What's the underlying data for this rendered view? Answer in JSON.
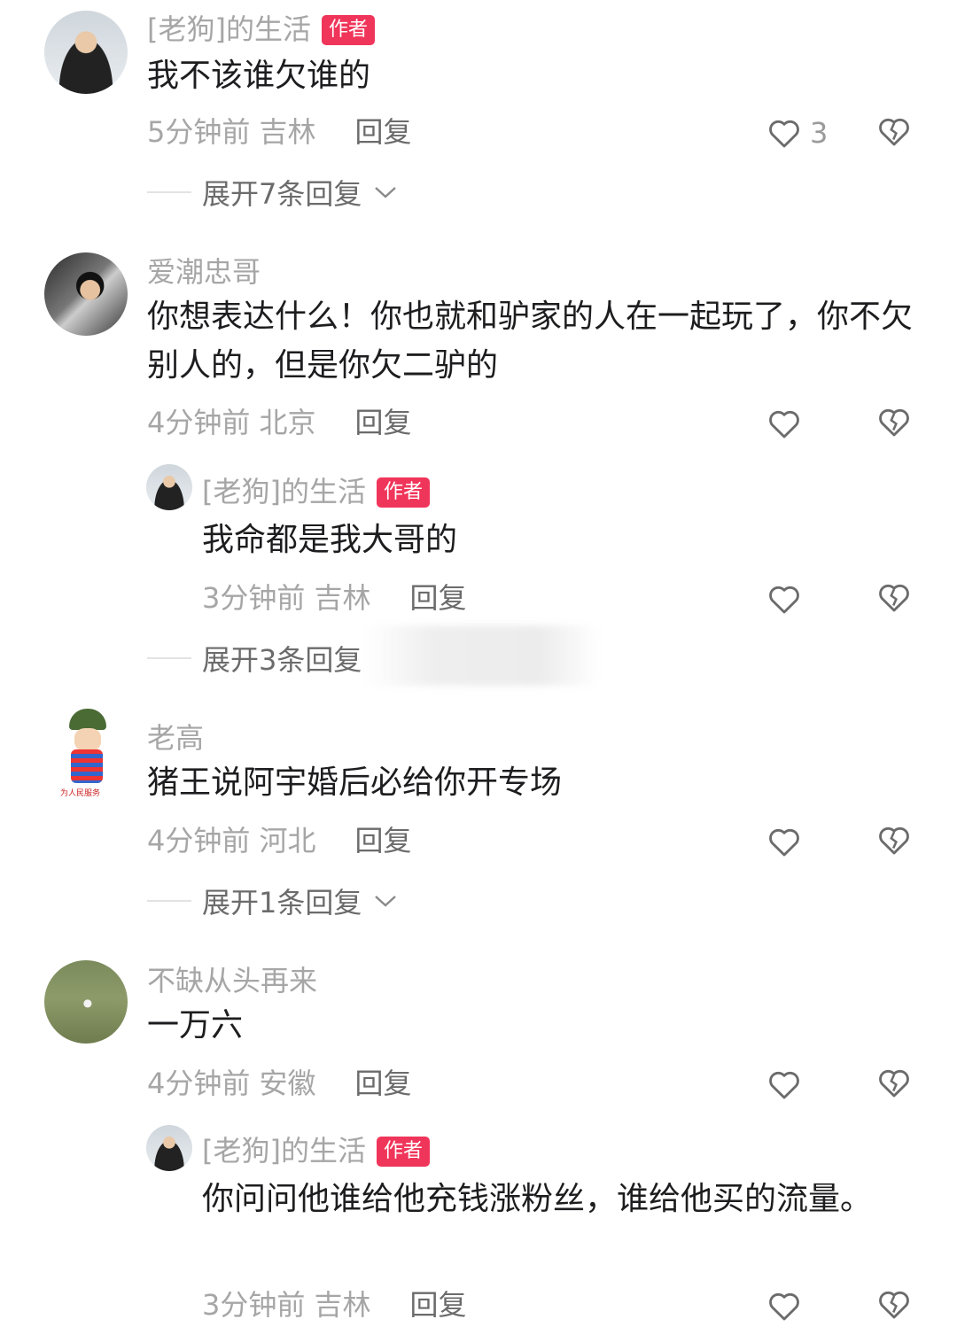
{
  "comments": [
    {
      "name": "[老狗]的生活",
      "badge": "作者",
      "text": "我不该谁欠谁的",
      "time_location": "5分钟前 吉林",
      "reply_label": "回复",
      "likes": "3",
      "expand": "展开7条回复"
    },
    {
      "name": "爱潮忠哥",
      "text": "你想表达什么！你也就和驴家的人在一起玩了，你不欠别人的，但是你欠二驴的",
      "time_location": "4分钟前 北京",
      "reply_label": "回复",
      "replies": [
        {
          "name": "[老狗]的生活",
          "badge": "作者",
          "text": "我命都是我大哥的",
          "time_location": "3分钟前 吉林",
          "reply_label": "回复"
        }
      ],
      "expand": "展开3条回复"
    },
    {
      "name": "老高",
      "avatar_caption": "为人民服务",
      "text": "猪王说阿宇婚后必给你开专场",
      "time_location": "4分钟前 河北",
      "reply_label": "回复",
      "expand": "展开1条回复"
    },
    {
      "name": "不缺从头再来",
      "text": "一万六",
      "time_location": "4分钟前 安徽",
      "reply_label": "回复",
      "replies": [
        {
          "name": "[老狗]的生活",
          "badge": "作者",
          "text": "你问问他谁给他充钱涨粉丝，谁给他买的流量。",
          "time_location": "3分钟前 吉林",
          "reply_label": "回复"
        }
      ]
    }
  ],
  "icons": {
    "like": "heart-outline-icon",
    "dislike": "broken-heart-icon",
    "expand": "chevron-down-icon"
  },
  "colors": {
    "badge": "#f0355a",
    "secondary_text": "#a6a6a6",
    "reply_text": "#6b6b6b"
  }
}
